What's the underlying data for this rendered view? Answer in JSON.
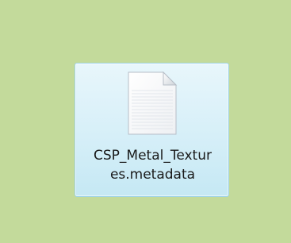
{
  "desktop": {
    "background_color": "#c3da9b",
    "selected_item": {
      "icon": "generic-document-file-icon",
      "name_line_1": "CSP_Metal_Textur",
      "name_line_2": "es.metadata",
      "selection_color": "#d6eff8"
    }
  }
}
